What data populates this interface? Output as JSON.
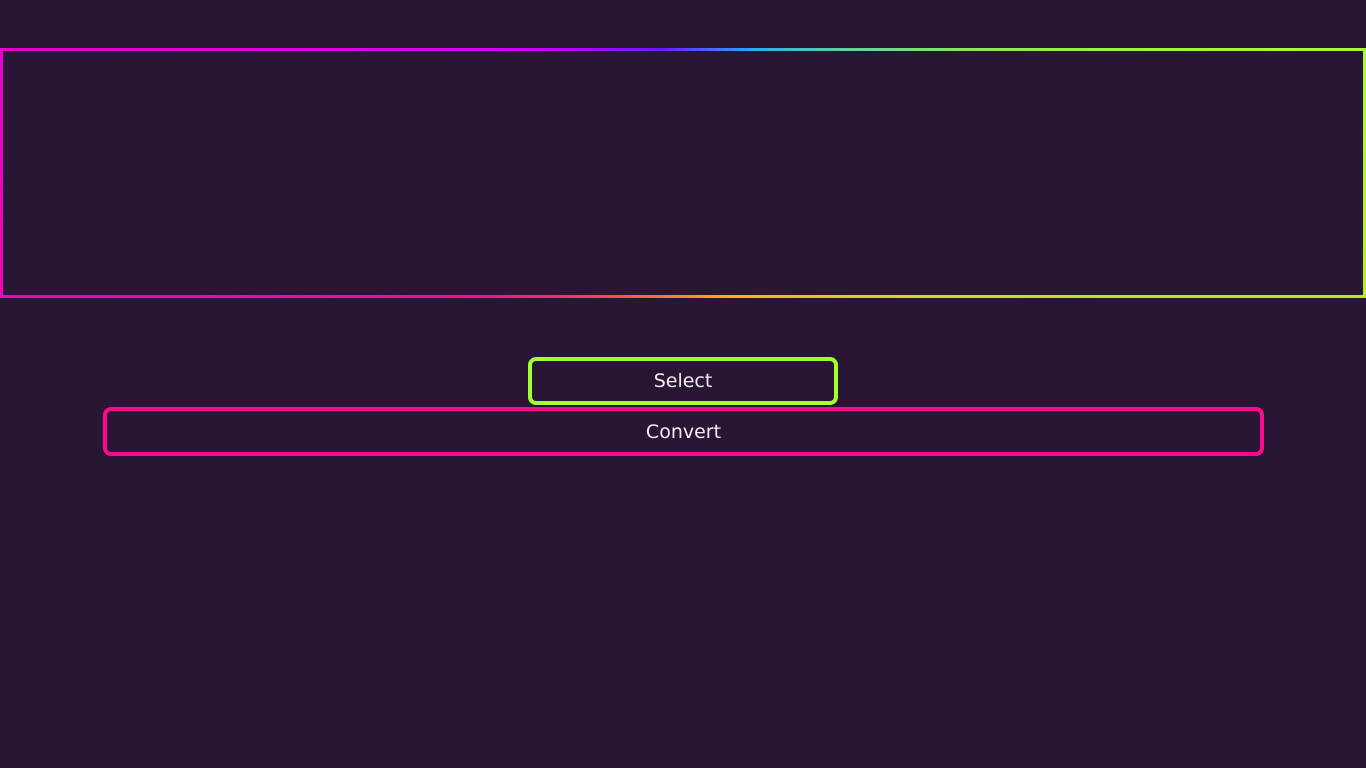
{
  "actions": {
    "select_label": "Select",
    "convert_label": "Convert"
  },
  "colors": {
    "background": "#281634",
    "select_border": "#a3ff2e",
    "convert_border": "#ff0a8f",
    "text": "#f2eef5"
  }
}
